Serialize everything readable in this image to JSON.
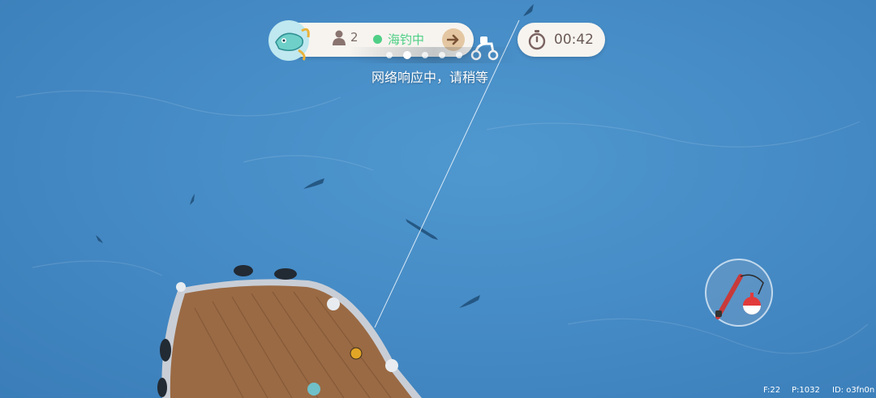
{
  "hud": {
    "player_count": "2",
    "status_label": "海钓中",
    "timer": "00:42"
  },
  "notice": {
    "text": "网络响应中，请稍等"
  },
  "debug": {
    "frame": "F:22",
    "ping": "P:1032",
    "id": "ID: o3fn0n"
  },
  "colors": {
    "sea": "#4489c4",
    "status_green": "#4fcf86",
    "pill_bg": "#f7f4ef",
    "deck": "#8a5a3a"
  },
  "icons": [
    "fish-badge-icon",
    "person-icon",
    "status-dot-icon",
    "arrow-right-icon",
    "scooter-icon",
    "stopwatch-icon",
    "fishing-rod-icon"
  ]
}
